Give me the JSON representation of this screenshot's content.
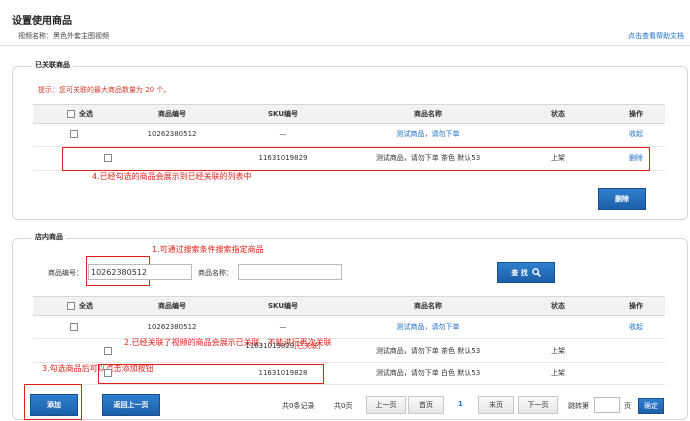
{
  "page": {
    "title": "设置使用商品",
    "video_name": "视频名称：黑色外套主图视频",
    "help_link": "点击查看帮助文档"
  },
  "linked": {
    "title": "已关联商品",
    "limit_note": "提示：您可关联的最大商品数量为 20 个。",
    "headers": {
      "select_all": "全选",
      "product_code": "商品编号",
      "sku_code": "SKU编号",
      "product_name": "商品名称",
      "status": "状态",
      "action": "操作"
    },
    "rows": [
      {
        "product_code": "10262380512",
        "sku_code": "—",
        "product_name": "测试商品，请勿下单",
        "status": "",
        "action": "收起"
      },
      {
        "product_code": "",
        "sku_code": "11631019829",
        "product_name": "测试商品，请勿下单 茶色 默认53",
        "status": "上架",
        "action": "删除"
      }
    ],
    "delete_button": "删除",
    "annotation": "4.已经勾选的商品会展示到已经关联的列表中"
  },
  "store": {
    "title": "店内商品",
    "search": {
      "code_label": "商品编号：",
      "code_value": "10262380512",
      "name_label": "商品名称：",
      "name_value": "",
      "search_button": "查 找"
    },
    "annotation_search": "1.可通过搜索条件搜索指定商品",
    "headers": {
      "select_all": "全选",
      "product_code": "商品编号",
      "sku_code": "SKU编号",
      "product_name": "商品名称",
      "status": "状态",
      "action": "操作"
    },
    "rows": [
      {
        "product_code": "10262380512",
        "sku_code": "—",
        "product_name": "测试商品，请勿下单",
        "status": "",
        "action": "收起"
      },
      {
        "product_code": "",
        "sku_code": "11631019829",
        "sku_tag": "[已关联]",
        "product_name": "测试商品，请勿下单 茶色 默认53",
        "status": "上架",
        "action": ""
      },
      {
        "product_code": "",
        "sku_code": "11631019828",
        "product_name": "测试商品，请勿下单 白色 默认53",
        "status": "上架",
        "action": ""
      }
    ],
    "annotation_linked": "2.已经关联了视频的商品会展示已关联，不能进行再次关联",
    "annotation_add": "3.勾选商品后可以点击添加按钮",
    "add_button": "添加",
    "back_button": "返回上一页",
    "pager": {
      "total_records": "共0条记录",
      "total_pages": "共0页",
      "prev": "上一页",
      "first": "首页",
      "current": "1",
      "last": "末页",
      "next": "下一页",
      "goto_label": "跳转第",
      "page_unit": "页",
      "confirm": "确定"
    }
  }
}
